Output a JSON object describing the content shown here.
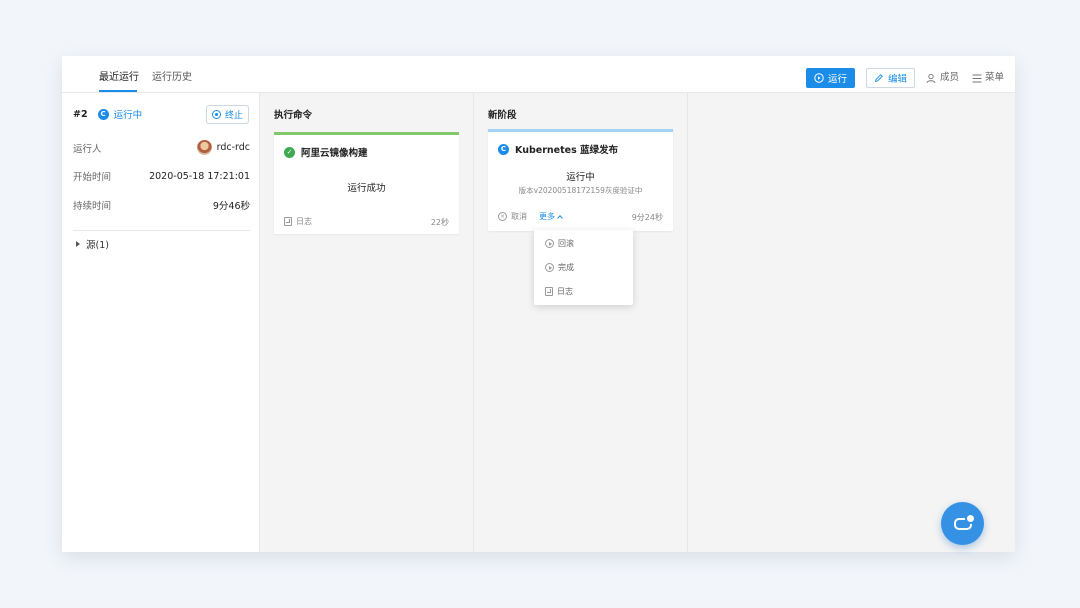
{
  "topbar": {
    "tabs": [
      {
        "label": "最近运行",
        "active": true
      },
      {
        "label": "运行历史",
        "active": false
      }
    ],
    "run_button": "运行",
    "edit_button": "编辑",
    "members_button": "成员",
    "menu_button": "菜单"
  },
  "run": {
    "number": "#2",
    "status_icon": "C",
    "status": "运行中",
    "stop_button": "终止",
    "info": [
      {
        "label": "运行人",
        "value": "rdc-rdc"
      },
      {
        "label": "开始时间",
        "value": "2020-05-18 17:21:01"
      },
      {
        "label": "持续时间",
        "value": "9分46秒"
      }
    ],
    "source": "源(1)"
  },
  "stages": [
    {
      "title": "执行命令",
      "card": {
        "title": "阿里云镜像构建",
        "status": "运行成功",
        "log_label": "日志",
        "duration": "22秒",
        "accent": "#82c86b"
      }
    },
    {
      "title": "新阶段",
      "card": {
        "title_icon": "C",
        "title": "Kubernetes 蓝绿发布",
        "status": "运行中",
        "subtitle": "版本v20200518172159灰度验证中",
        "cancel_label": "取消",
        "more_label": "更多",
        "duration": "9分24秒",
        "accent": "#a6d2f3"
      }
    }
  ],
  "dropdown": {
    "items": [
      {
        "label": "回滚",
        "icon": "play-circle-icon"
      },
      {
        "label": "完成",
        "icon": "play-circle-icon"
      },
      {
        "label": "日志",
        "icon": "log-icon"
      }
    ]
  },
  "colors": {
    "accent": "#1b8de9",
    "success": "#3fa951",
    "background": "#f2f6fa"
  }
}
